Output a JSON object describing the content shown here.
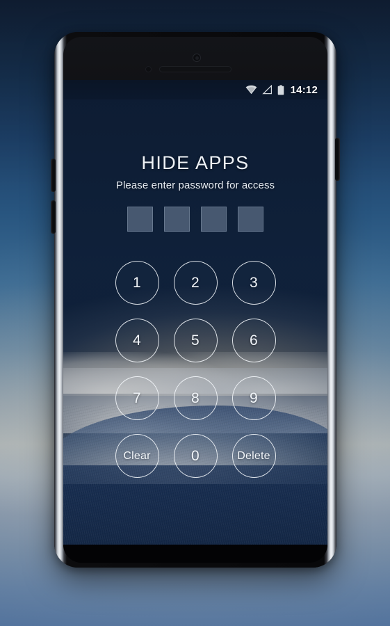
{
  "wallpaper": {
    "description": "blue sand dunes at dusk",
    "sky_color": "#0d1b30",
    "dune_highlight": "#e2e6ea",
    "shadow_color": "#1a3258"
  },
  "page_background": {
    "top_color": "#13243d",
    "bottom_color": "#50719c"
  },
  "phone": {
    "frame_color": "#0a0a0c",
    "rim_color": "#eef1f4",
    "hardware": {
      "earpiece": "earpiece-speaker",
      "front_camera": "front-camera",
      "proximity_sensor": "proximity-sensor",
      "volume_up": "volume-up-button",
      "volume_down": "volume-down-button",
      "power": "power-button"
    }
  },
  "status_bar": {
    "time": "14:12",
    "icons": [
      {
        "name": "wifi-icon",
        "label": "Wi-Fi"
      },
      {
        "name": "signal-icon",
        "label": "Signal"
      },
      {
        "name": "battery-icon",
        "label": "Battery"
      }
    ],
    "icon_color": "#d4d9de",
    "time_color": "#ffffff"
  },
  "lock_screen": {
    "title": "HIDE APPS",
    "subtitle": "Please enter password for access",
    "title_color": "#eef2f6",
    "subtitle_color": "#e6ecf2",
    "password": {
      "length": 4,
      "entered": 0,
      "box_fill": "#96a8be",
      "boxes": [
        "",
        "",
        "",
        ""
      ]
    },
    "keypad": {
      "accent_color": "#f5f8fc",
      "keys": [
        {
          "name": "key-1",
          "label": "1",
          "type": "digit"
        },
        {
          "name": "key-2",
          "label": "2",
          "type": "digit"
        },
        {
          "name": "key-3",
          "label": "3",
          "type": "digit"
        },
        {
          "name": "key-4",
          "label": "4",
          "type": "digit"
        },
        {
          "name": "key-5",
          "label": "5",
          "type": "digit"
        },
        {
          "name": "key-6",
          "label": "6",
          "type": "digit"
        },
        {
          "name": "key-7",
          "label": "7",
          "type": "digit"
        },
        {
          "name": "key-8",
          "label": "8",
          "type": "digit"
        },
        {
          "name": "key-9",
          "label": "9",
          "type": "digit"
        },
        {
          "name": "key-clear",
          "label": "Clear",
          "type": "word"
        },
        {
          "name": "key-0",
          "label": "0",
          "type": "digit"
        },
        {
          "name": "key-delete",
          "label": "Delete",
          "type": "word"
        }
      ]
    }
  }
}
